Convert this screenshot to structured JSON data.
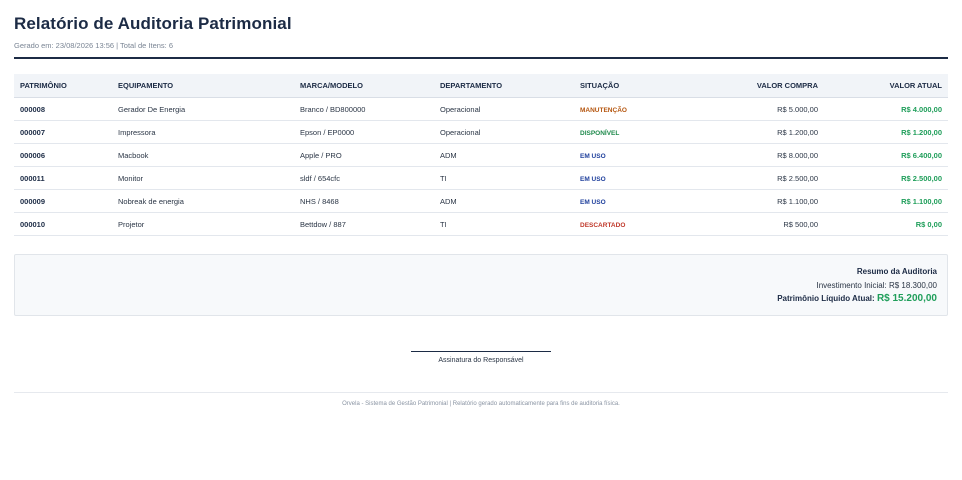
{
  "header": {
    "title": "Relatório de Auditoria Patrimonial",
    "subtitle": "Gerado em: 23/08/2026 13:56 | Total de Itens: 6"
  },
  "table": {
    "columns": [
      "PATRIMÔNIO",
      "EQUIPAMENTO",
      "MARCA/MODELO",
      "DEPARTAMENTO",
      "SITUAÇÃO",
      "VALOR COMPRA",
      "VALOR ATUAL"
    ],
    "rows": [
      {
        "id": "000008",
        "equipment": "Gerador De Energia",
        "brand": "Branco / BD800000",
        "department": "Operacional",
        "status": "MANUTENÇÃO",
        "purchase": "R$ 5.000,00",
        "current": "R$ 4.000,00"
      },
      {
        "id": "000007",
        "equipment": "Impressora",
        "brand": "Epson / EP0000",
        "department": "Operacional",
        "status": "DISPONÍVEL",
        "purchase": "R$ 1.200,00",
        "current": "R$ 1.200,00"
      },
      {
        "id": "000006",
        "equipment": "Macbook",
        "brand": "Apple / PRO",
        "department": "ADM",
        "status": "EM USO",
        "purchase": "R$ 8.000,00",
        "current": "R$ 6.400,00"
      },
      {
        "id": "000011",
        "equipment": "Monitor",
        "brand": "sldf / 654cfc",
        "department": "TI",
        "status": "EM USO",
        "purchase": "R$ 2.500,00",
        "current": "R$ 2.500,00"
      },
      {
        "id": "000009",
        "equipment": "Nobreak de energia",
        "brand": "NHS / 8468",
        "department": "ADM",
        "status": "EM USO",
        "purchase": "R$ 1.100,00",
        "current": "R$ 1.100,00"
      },
      {
        "id": "000010",
        "equipment": "Projetor",
        "brand": "Bettdow / 887",
        "department": "TI",
        "status": "DESCARTADO",
        "purchase": "R$ 500,00",
        "current": "R$ 0,00"
      }
    ]
  },
  "summary": {
    "title": "Resumo da Auditoria",
    "investment": "Investimento Inicial: R$ 18.300,00",
    "net_label": "Patrimônio Líquido Atual:",
    "net_value": "R$ 15.200,00"
  },
  "signature": {
    "label": "Assinatura do Responsável"
  },
  "footer": {
    "text": "Orvela - Sistema de Gestão Patrimonial | Relatório gerado automaticamente para fins de auditoria física."
  },
  "colors": {
    "primary": "#1c2b45",
    "value_green": "#1f9e5a",
    "status_maintenance": "#b5560f",
    "status_available": "#1f8a4c",
    "status_in_use": "#1e3f9c",
    "status_discarded": "#c0392b"
  }
}
